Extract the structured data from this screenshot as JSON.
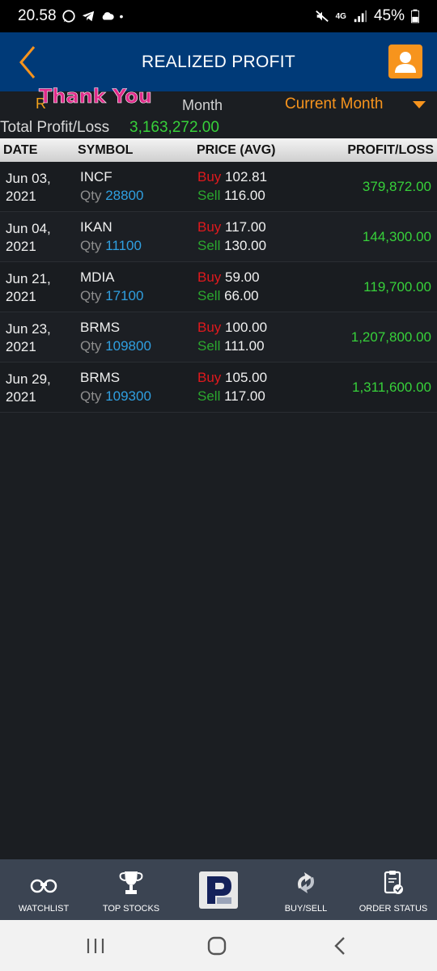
{
  "status_bar": {
    "time": "20.58",
    "dot": "•",
    "network": "4G",
    "battery": "45%",
    "icons": [
      "whatsapp-icon",
      "telegram-icon",
      "cloud-icon",
      "mute-icon",
      "signal-icon",
      "battery-icon"
    ]
  },
  "header": {
    "title": "REALIZED PROFIT",
    "back_icon": "chevron-left-icon",
    "profile_icon": "user-icon",
    "accent": "#f7941d",
    "bg": "#003a78"
  },
  "filter": {
    "thank_you_text": "Thank You",
    "label_partial": "R",
    "month_label": "Month",
    "selected_period": "Current Month"
  },
  "total": {
    "label": "Total Profit/Loss",
    "value": "3,163,272.00"
  },
  "table": {
    "columns": [
      "DATE",
      "SYMBOL",
      "PRICE (AVG)",
      "PROFIT/LOSS"
    ],
    "buy_label": "Buy",
    "sell_label": "Sell",
    "qty_label": "Qty",
    "rows": [
      {
        "date_line1": "Jun 03,",
        "date_line2": "2021",
        "symbol": "INCF",
        "qty": "28800",
        "buy": "102.81",
        "sell": "116.00",
        "pl": "379,872.00"
      },
      {
        "date_line1": "Jun 04,",
        "date_line2": "2021",
        "symbol": "IKAN",
        "qty": "11100",
        "buy": "117.00",
        "sell": "130.00",
        "pl": "144,300.00"
      },
      {
        "date_line1": "Jun 21,",
        "date_line2": "2021",
        "symbol": "MDIA",
        "qty": "17100",
        "buy": "59.00",
        "sell": "66.00",
        "pl": "119,700.00"
      },
      {
        "date_line1": "Jun 23,",
        "date_line2": "2021",
        "symbol": "BRMS",
        "qty": "109800",
        "buy": "100.00",
        "sell": "111.00",
        "pl": "1,207,800.00"
      },
      {
        "date_line1": "Jun 29,",
        "date_line2": "2021",
        "symbol": "BRMS",
        "qty": "109300",
        "buy": "105.00",
        "sell": "117.00",
        "pl": "1,311,600.00"
      }
    ]
  },
  "bottom_nav": {
    "items": [
      {
        "label": "WATCHLIST",
        "icon": "binoculars-icon"
      },
      {
        "label": "TOP STOCKS",
        "icon": "trophy-icon"
      },
      {
        "label": "",
        "icon": "app-logo-icon"
      },
      {
        "label": "BUY/SELL",
        "icon": "buy-sell-icon"
      },
      {
        "label": "ORDER STATUS",
        "icon": "clipboard-check-icon"
      }
    ]
  },
  "system_nav": {
    "icons": [
      "recent-apps-icon",
      "home-icon",
      "back-icon"
    ]
  },
  "colors": {
    "profit_green": "#37d13a",
    "buy_red": "#e0191d",
    "sell_green": "#2ba82e",
    "qty_blue": "#2f9fe0"
  }
}
